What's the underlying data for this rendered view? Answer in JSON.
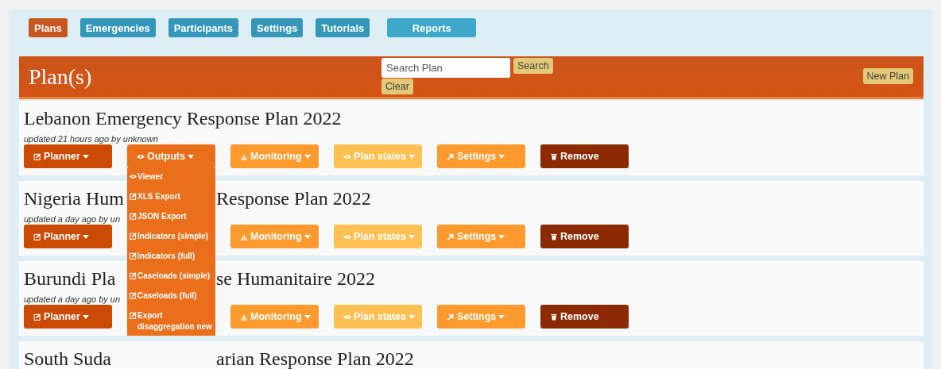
{
  "nav": [
    {
      "label": "Plans",
      "selected": true
    },
    {
      "label": "Emergencies",
      "selected": false
    },
    {
      "label": "Participants",
      "selected": false
    },
    {
      "label": "Settings",
      "selected": false
    },
    {
      "label": "Tutorials",
      "selected": false
    },
    {
      "label": "Reports",
      "selected": false
    }
  ],
  "header": {
    "title": "Plan(s)",
    "search": {
      "placeholder": "Search Plan"
    },
    "search_button": "Search",
    "clear_button": "Clear",
    "new_button": "New Plan"
  },
  "plans": [
    {
      "title": [
        "Lebanon Emergency Response Plan 2022"
      ],
      "updated": "updated 21 hours ago by unknown",
      "buttons": [
        {
          "kind": "planner",
          "label": "Planner"
        },
        {
          "kind": "outputs",
          "label": "Outputs",
          "expanded": true,
          "menu": [
            {
              "kind": "view",
              "label": "Viewer"
            },
            {
              "kind": "edit",
              "label": "XLS Export"
            },
            {
              "kind": "edit",
              "label": "JSON Export"
            },
            {
              "kind": "edit",
              "label": "Indicators (simple)"
            },
            {
              "kind": "edit",
              "label": "Indicators (full)"
            },
            {
              "kind": "edit",
              "label": "Caseloads (simple)"
            },
            {
              "kind": "edit",
              "label": "Caseloads (full)"
            },
            {
              "kind": "edit",
              "label": "Export disaggregation new"
            }
          ]
        },
        {
          "kind": "monitoring",
          "label": "Monitoring"
        },
        {
          "kind": "states",
          "label": "Plan states"
        },
        {
          "kind": "settings",
          "label": "Settings"
        },
        {
          "kind": "remove",
          "label": "Remove"
        }
      ]
    },
    {
      "title": [
        "Nigeria Hum",
        "Response Plan 2022"
      ],
      "updated": "updated a day ago by un",
      "buttons": [
        {
          "kind": "planner",
          "label": "Planner"
        },
        {
          "kind": "monitoring",
          "label": "Monitoring"
        },
        {
          "kind": "states",
          "label": "Plan states"
        },
        {
          "kind": "settings",
          "label": "Settings"
        },
        {
          "kind": "remove",
          "label": "Remove"
        }
      ]
    },
    {
      "title": [
        "Burundi Pla",
        "se Humanitaire 2022"
      ],
      "updated": "updated a day ago by un",
      "buttons": [
        {
          "kind": "planner",
          "label": "Planner"
        },
        {
          "kind": "monitoring",
          "label": "Monitoring"
        },
        {
          "kind": "states",
          "label": "Plan states"
        },
        {
          "kind": "settings",
          "label": "Settings"
        },
        {
          "kind": "remove",
          "label": "Remove"
        }
      ]
    },
    {
      "title": [
        "South Suda",
        "arian Response Plan 2022"
      ]
    }
  ]
}
